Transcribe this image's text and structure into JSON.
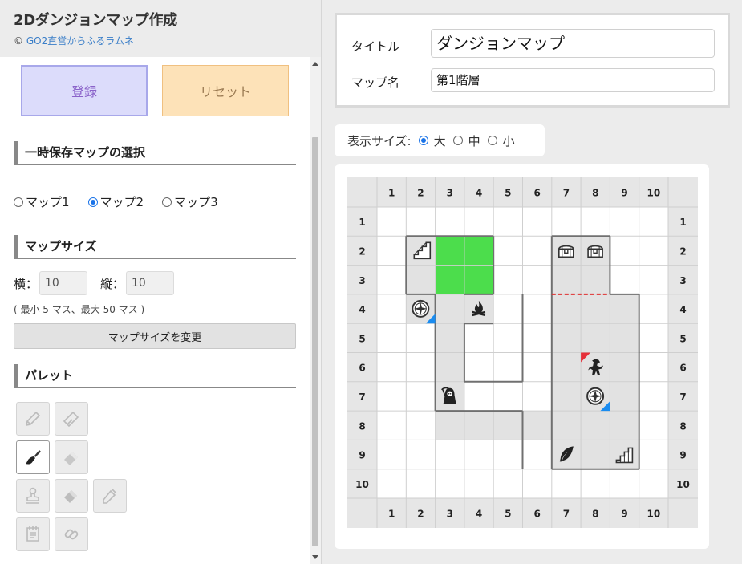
{
  "app": {
    "title": "2Dダンジョンマップ作成",
    "credit_prefix": "©",
    "credit_link": "GO2直営からふるラムネ"
  },
  "buttons": {
    "register": "登録",
    "reset": "リセット"
  },
  "temp_save": {
    "heading": "一時保存マップの選択",
    "options": [
      {
        "label": "マップ1",
        "checked": false
      },
      {
        "label": "マップ2",
        "checked": true
      },
      {
        "label": "マップ3",
        "checked": false
      }
    ]
  },
  "map_size": {
    "heading": "マップサイズ",
    "width_label": "横：",
    "width_value": "10",
    "height_label": "縦：",
    "height_value": "10",
    "note": "( 最小 5 マス、最大 50 マス )",
    "change_button": "マップサイズを変更"
  },
  "palette": {
    "heading": "パレット",
    "tools": [
      {
        "name": "pencil-icon",
        "active": false
      },
      {
        "name": "eraser-outline-icon",
        "active": false
      },
      {
        "name": "paint-brush-icon",
        "active": true
      },
      {
        "name": "eraser-icon",
        "active": false
      },
      {
        "name": "stamp-icon",
        "active": false
      },
      {
        "name": "eraser-solid-icon",
        "active": false
      },
      {
        "name": "eyedropper-icon",
        "active": false
      },
      {
        "name": "notepad-icon",
        "active": false
      },
      {
        "name": "link-icon",
        "active": false
      }
    ]
  },
  "info": {
    "title_label": "タイトル",
    "title_value": "ダンジョンマップ",
    "mapname_label": "マップ名",
    "mapname_value": "第1階層"
  },
  "display_size": {
    "label": "表示サイズ:",
    "options": [
      {
        "label": "大",
        "checked": true
      },
      {
        "label": "中",
        "checked": false
      },
      {
        "label": "小",
        "checked": false
      }
    ]
  },
  "map": {
    "cols": [
      "1",
      "2",
      "3",
      "4",
      "5",
      "6",
      "7",
      "8",
      "9",
      "10"
    ],
    "rows": [
      "1",
      "2",
      "3",
      "4",
      "5",
      "6",
      "7",
      "8",
      "9",
      "10"
    ],
    "floor_cells": [
      [
        2,
        2
      ],
      [
        3,
        2
      ],
      [
        4,
        2
      ],
      [
        2,
        3
      ],
      [
        3,
        3
      ],
      [
        4,
        3
      ],
      [
        2,
        4
      ],
      [
        3,
        4
      ],
      [
        4,
        4
      ],
      [
        3,
        5
      ],
      [
        3,
        6
      ],
      [
        3,
        7
      ],
      [
        3,
        8
      ],
      [
        4,
        8
      ],
      [
        5,
        8
      ],
      [
        6,
        8
      ],
      [
        7,
        2
      ],
      [
        8,
        2
      ],
      [
        7,
        3
      ],
      [
        8,
        3
      ],
      [
        7,
        4
      ],
      [
        8,
        4
      ],
      [
        9,
        4
      ],
      [
        7,
        5
      ],
      [
        8,
        5
      ],
      [
        9,
        5
      ],
      [
        7,
        6
      ],
      [
        8,
        6
      ],
      [
        9,
        6
      ],
      [
        7,
        7
      ],
      [
        8,
        7
      ],
      [
        9,
        7
      ],
      [
        7,
        8
      ],
      [
        8,
        8
      ],
      [
        9,
        8
      ],
      [
        7,
        9
      ],
      [
        8,
        9
      ],
      [
        9,
        9
      ]
    ],
    "green_cells": [
      [
        3,
        2
      ],
      [
        4,
        2
      ],
      [
        3,
        3
      ],
      [
        4,
        3
      ]
    ],
    "walls": [
      [
        1,
        1,
        4,
        1
      ],
      [
        1,
        1,
        1,
        3
      ],
      [
        4,
        1,
        4,
        3
      ],
      [
        1,
        3,
        2,
        3
      ],
      [
        2,
        3,
        2,
        7
      ],
      [
        3,
        4,
        3,
        6
      ],
      [
        3,
        4,
        4,
        4
      ],
      [
        3,
        6,
        5,
        6
      ],
      [
        5,
        6,
        5,
        3
      ],
      [
        2,
        7,
        5,
        7
      ],
      [
        5,
        7,
        5,
        9
      ],
      [
        3,
        3,
        4,
        3
      ],
      [
        6,
        1,
        8,
        1
      ],
      [
        6,
        1,
        6,
        9
      ],
      [
        8,
        1,
        8,
        3
      ],
      [
        8,
        3,
        9,
        3
      ],
      [
        9,
        3,
        9,
        9
      ],
      [
        6,
        9,
        9,
        9
      ]
    ],
    "dashed_walls": [
      [
        6,
        3,
        8,
        3
      ]
    ],
    "objects": [
      {
        "name": "stairs-up-icon",
        "col": 2,
        "row": 2
      },
      {
        "name": "compass-icon",
        "col": 2,
        "row": 4
      },
      {
        "name": "campfire-icon",
        "col": 4,
        "row": 4
      },
      {
        "name": "chest-icon",
        "col": 7,
        "row": 2
      },
      {
        "name": "chest-icon",
        "col": 8,
        "row": 2
      },
      {
        "name": "monster-icon",
        "col": 8,
        "row": 6
      },
      {
        "name": "compass-icon",
        "col": 8,
        "row": 7
      },
      {
        "name": "grim-reaper-icon",
        "col": 3,
        "row": 7
      },
      {
        "name": "feather-icon",
        "col": 7,
        "row": 9
      },
      {
        "name": "stairs-down-icon",
        "col": 9,
        "row": 9
      }
    ],
    "markers": [
      {
        "type": "blue-corner",
        "col": 2,
        "row": 4
      },
      {
        "type": "blue-corner",
        "col": 8,
        "row": 7
      },
      {
        "type": "red-corner",
        "col": 8,
        "row": 6
      }
    ],
    "colors": {
      "floor": "#e2e2e2",
      "green": "#4cdd4c",
      "wall": "#707070",
      "dashed": "#e03030",
      "header": "#e6e6e6",
      "grid": "#cfcfcf",
      "blue": "#1a8cf0",
      "red": "#e6303a"
    }
  }
}
